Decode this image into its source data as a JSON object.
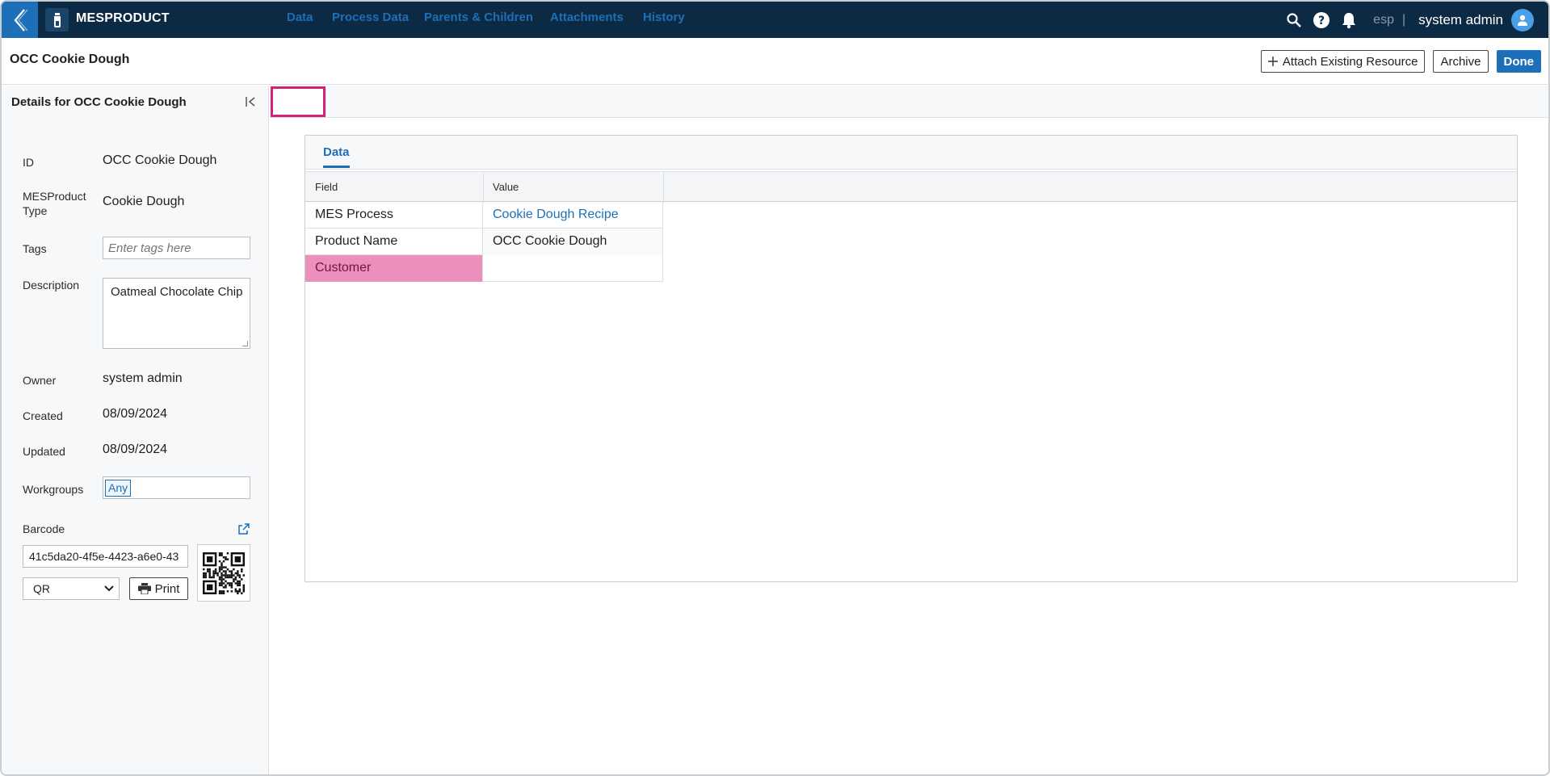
{
  "app": {
    "title": "MESPRODUCT"
  },
  "topbar": {
    "tenant": "esp",
    "separator": "|",
    "user_name": "system admin"
  },
  "header": {
    "title": "OCC Cookie Dough",
    "attach_label": "Attach Existing Resource",
    "archive_label": "Archive",
    "done_label": "Done"
  },
  "sidebar": {
    "title": "Details for OCC Cookie Dough",
    "fields": {
      "id": {
        "label": "ID",
        "value": "OCC Cookie Dough"
      },
      "type": {
        "label": "MESProduct Type",
        "value": "Cookie Dough"
      },
      "tags": {
        "label": "Tags",
        "placeholder": "Enter tags here"
      },
      "description": {
        "label": "Description",
        "value": "Oatmeal Chocolate Chip"
      },
      "owner": {
        "label": "Owner",
        "value": "system admin"
      },
      "created": {
        "label": "Created",
        "value": "08/09/2024"
      },
      "updated": {
        "label": "Updated",
        "value": "08/09/2024"
      },
      "workgroups": {
        "label": "Workgroups",
        "chip": "Any"
      }
    },
    "barcode": {
      "label": "Barcode",
      "value": "41c5da20-4f5e-4423-a6e0-43",
      "type": "QR",
      "print_label": "Print"
    }
  },
  "tabs": [
    {
      "label": "Data",
      "active": true
    },
    {
      "label": "Process Data"
    },
    {
      "label": "Parents & Children"
    },
    {
      "label": "Attachments"
    },
    {
      "label": "History"
    }
  ],
  "panel": {
    "tab_label": "Data",
    "columns": [
      "Field",
      "Value"
    ],
    "rows": [
      {
        "field": "MES Process",
        "value": "Cookie Dough Recipe",
        "value_is_link": true
      },
      {
        "field": "Product Name",
        "value": "OCC Cookie Dough"
      },
      {
        "field": "Customer",
        "value": "",
        "required": true
      }
    ]
  },
  "colors": {
    "topbar": "#0c2a44",
    "accent": "#1d6fb8",
    "highlight_border": "#d6217a",
    "required_cell": "#ec8fbc"
  }
}
